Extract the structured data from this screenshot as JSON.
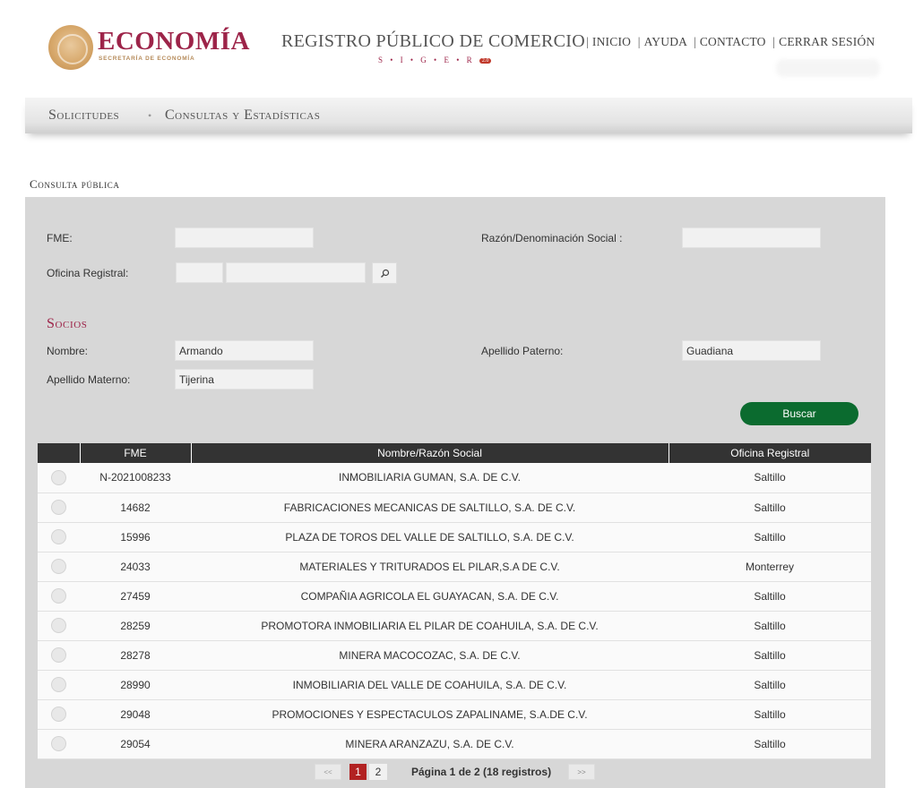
{
  "header": {
    "brand_name": "ECONOMÍA",
    "brand_subtitle": "SECRETARÍA DE ECONOMÍA",
    "registry_title": "REGISTRO PÚBLICO DE COMERCIO",
    "siger_letters": "S • I • G • E • R",
    "siger_badge": "2.0",
    "nav": [
      {
        "label": "INICIO"
      },
      {
        "label": "AYUDA"
      },
      {
        "label": "CONTACTO"
      },
      {
        "label": "CERRAR SESIÓN"
      }
    ]
  },
  "menu": {
    "items": [
      {
        "label": "Solicitudes"
      },
      {
        "label": "Consultas y Estadísticas"
      }
    ],
    "separator": "•"
  },
  "section_title": "Consulta pública",
  "form": {
    "fme_label": "FME:",
    "fme_value": "",
    "razon_label": "Razón/Denominación Social :",
    "razon_value": "",
    "oficina_label": "Oficina Registral:",
    "oficina_code_value": "",
    "oficina_name_value": "",
    "socios_title": "Socios",
    "nombre_label": "Nombre:",
    "nombre_value": "Armando",
    "ap_paterno_label": "Apellido Paterno:",
    "ap_paterno_value": "Guadiana",
    "ap_materno_label": "Apellido Materno:",
    "ap_materno_value": "Tijerina",
    "buscar_label": "Buscar"
  },
  "table": {
    "headers": {
      "select": "",
      "fme": "FME",
      "nombre": "Nombre/Razón Social",
      "oficina": "Oficina Registral"
    },
    "rows": [
      {
        "fme": "N-2021008233",
        "nombre": "INMOBILIARIA GUMAN, S.A. DE C.V.",
        "oficina": "Saltillo"
      },
      {
        "fme": "14682",
        "nombre": "FABRICACIONES MECANICAS DE SALTILLO, S.A. DE C.V.",
        "oficina": "Saltillo"
      },
      {
        "fme": "15996",
        "nombre": "PLAZA DE TOROS DEL VALLE DE SALTILLO, S.A. DE C.V.",
        "oficina": "Saltillo"
      },
      {
        "fme": "24033",
        "nombre": "MATERIALES Y TRITURADOS EL PILAR,S.A DE C.V.",
        "oficina": "Monterrey"
      },
      {
        "fme": "27459",
        "nombre": "COMPAÑIA AGRICOLA EL GUAYACAN, S.A. DE C.V.",
        "oficina": "Saltillo"
      },
      {
        "fme": "28259",
        "nombre": "PROMOTORA INMOBILIARIA EL PILAR DE COAHUILA, S.A. DE C.V.",
        "oficina": "Saltillo"
      },
      {
        "fme": "28278",
        "nombre": "MINERA MACOCOZAC, S.A. DE C.V.",
        "oficina": "Saltillo"
      },
      {
        "fme": "28990",
        "nombre": "INMOBILIARIA DEL VALLE DE COAHUILA, S.A. DE C.V.",
        "oficina": "Saltillo"
      },
      {
        "fme": "29048",
        "nombre": "PROMOCIONES Y ESPECTACULOS ZAPALINAME, S.A.DE C.V.",
        "oficina": "Saltillo"
      },
      {
        "fme": "29054",
        "nombre": "MINERA ARANZAZU, S.A. DE C.V.",
        "oficina": "Saltillo"
      }
    ]
  },
  "pagination": {
    "prev": "<<",
    "pages": [
      "1",
      "2"
    ],
    "current_page": "1",
    "info": "Página 1 de 2 (18 registros)",
    "next": ">>"
  },
  "colors": {
    "brand": "#9d2449",
    "accent_gold": "#b58a59",
    "buscar_green": "#0b6b2f",
    "active_page": "#b22222",
    "table_header": "#333333",
    "panel_bg": "#d7d7d7"
  },
  "icons": {
    "emblem": "national-emblem-icon",
    "search": "magnifier-icon"
  }
}
